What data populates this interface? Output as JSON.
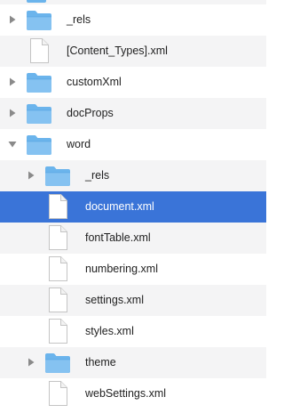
{
  "tree": {
    "rows": [
      {
        "label": "_rels",
        "kind": "folder",
        "depth": 0,
        "expanded": false,
        "selected": false
      },
      {
        "label": "[Content_Types].xml",
        "kind": "file",
        "depth": 0,
        "expanded": false,
        "selected": false
      },
      {
        "label": "customXml",
        "kind": "folder",
        "depth": 0,
        "expanded": false,
        "selected": false
      },
      {
        "label": "docProps",
        "kind": "folder",
        "depth": 0,
        "expanded": false,
        "selected": false
      },
      {
        "label": "word",
        "kind": "folder",
        "depth": 0,
        "expanded": true,
        "selected": false
      },
      {
        "label": "_rels",
        "kind": "folder",
        "depth": 1,
        "expanded": false,
        "selected": false
      },
      {
        "label": "document.xml",
        "kind": "file",
        "depth": 1,
        "expanded": false,
        "selected": true
      },
      {
        "label": "fontTable.xml",
        "kind": "file",
        "depth": 1,
        "expanded": false,
        "selected": false
      },
      {
        "label": "numbering.xml",
        "kind": "file",
        "depth": 1,
        "expanded": false,
        "selected": false
      },
      {
        "label": "settings.xml",
        "kind": "file",
        "depth": 1,
        "expanded": false,
        "selected": false
      },
      {
        "label": "styles.xml",
        "kind": "file",
        "depth": 1,
        "expanded": false,
        "selected": false
      },
      {
        "label": "theme",
        "kind": "folder",
        "depth": 1,
        "expanded": false,
        "selected": false
      },
      {
        "label": "webSettings.xml",
        "kind": "file",
        "depth": 1,
        "expanded": false,
        "selected": false
      }
    ]
  },
  "icons": {
    "folder": "folder-icon",
    "file": "document-icon",
    "collapsed": "disclosure-triangle-right-icon",
    "expanded": "disclosure-triangle-down-icon"
  },
  "colors": {
    "selection": "#3a74d8",
    "stripe": "#f4f4f5",
    "folder": "#6bb4ec",
    "text": "#1f1f1f"
  }
}
